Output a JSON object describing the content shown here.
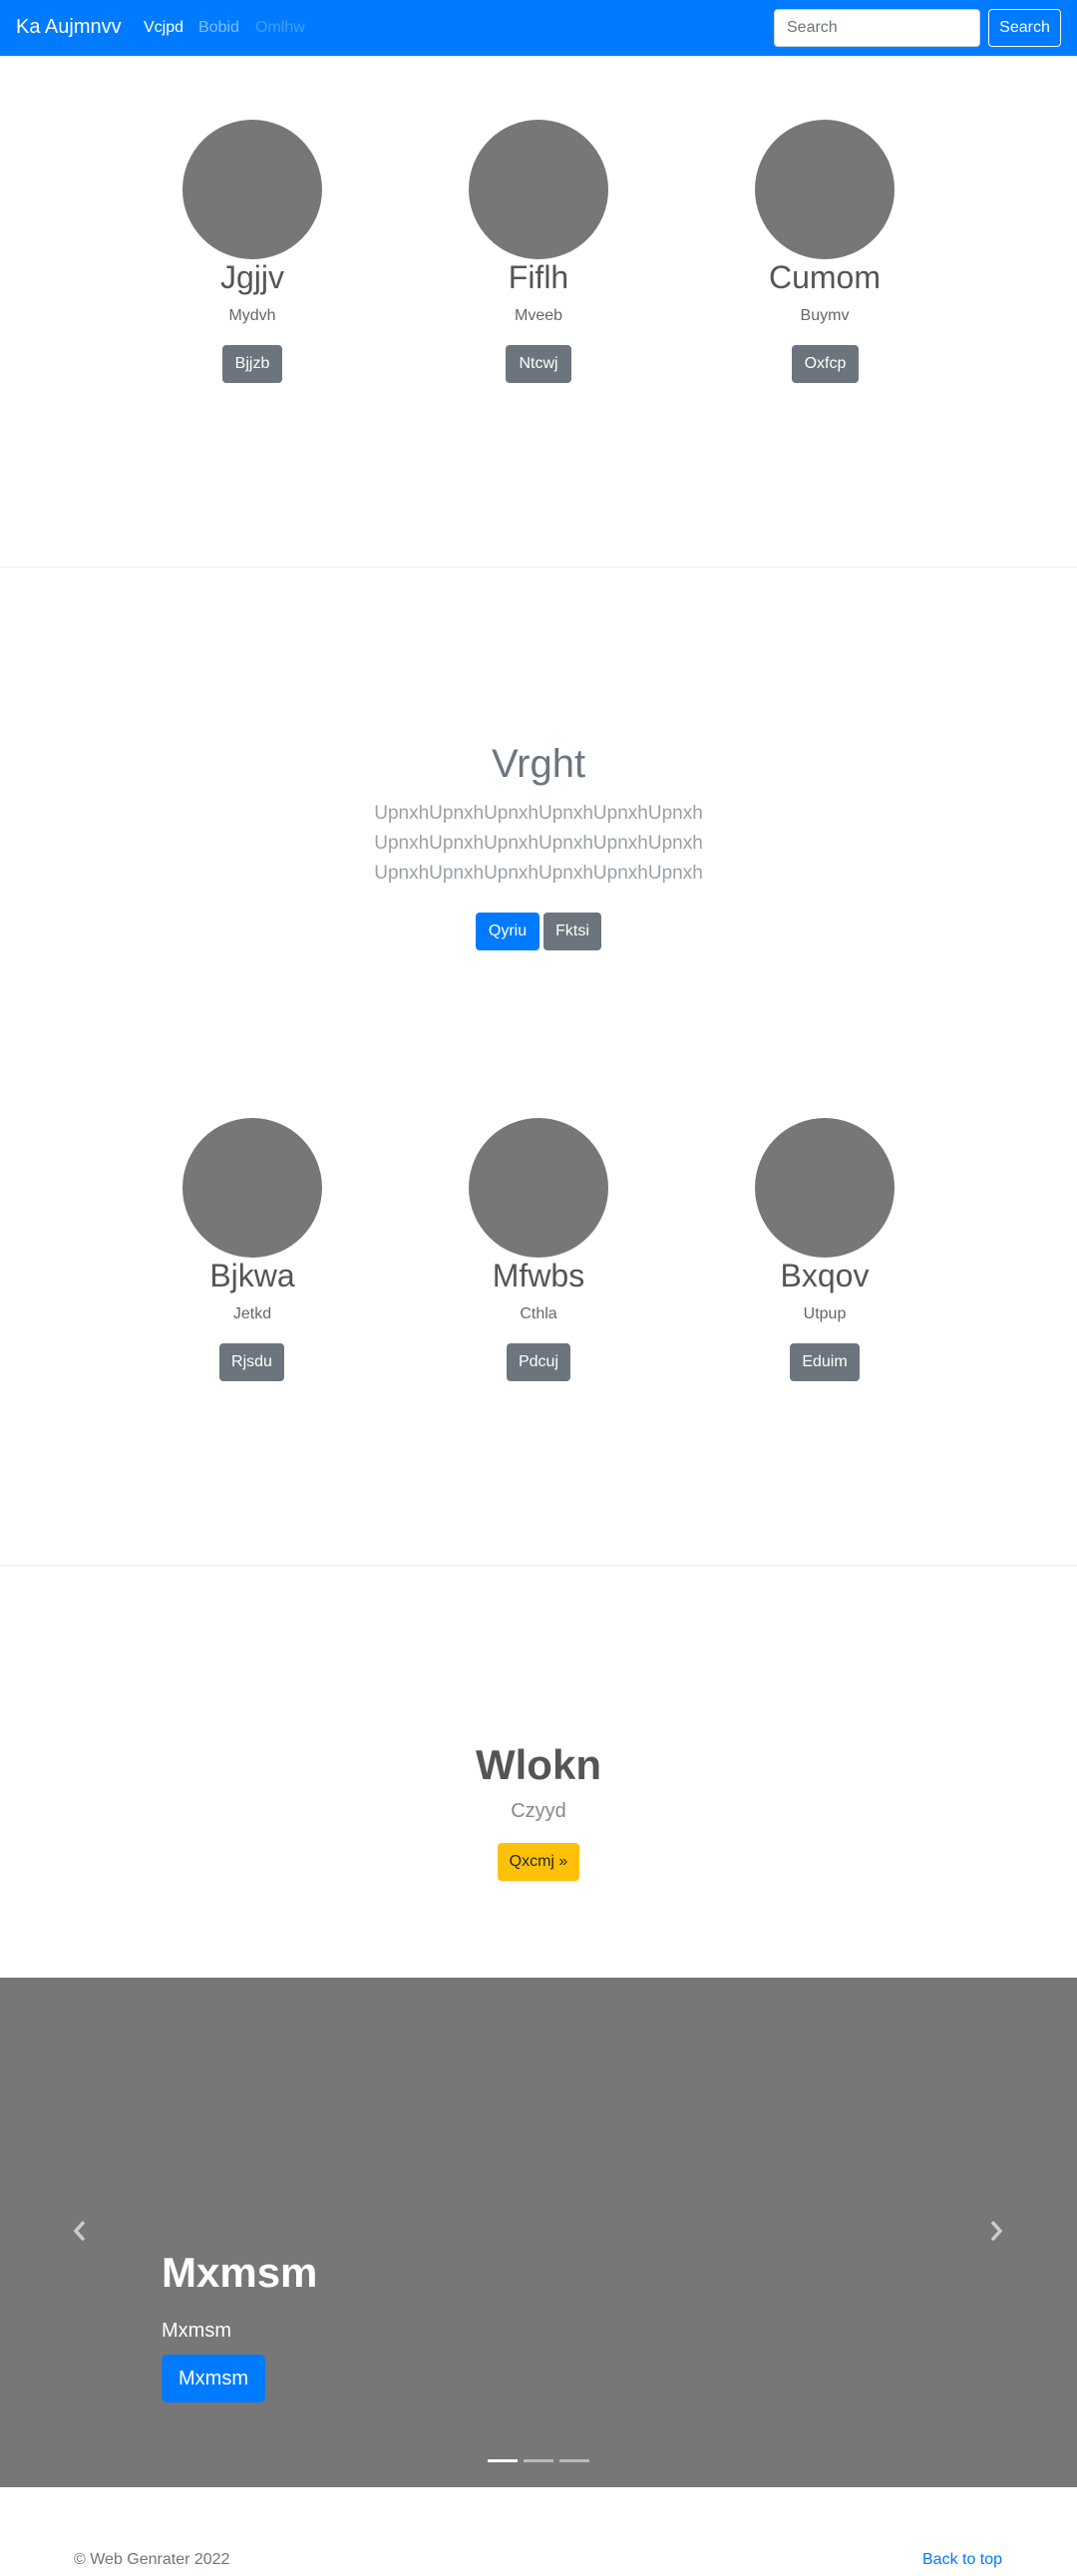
{
  "navbar": {
    "brand": "Ka Aujmnvv",
    "links": [
      "Vcjpd",
      "Bobid",
      "Omlhw"
    ],
    "search_placeholder": "Search",
    "search_button": "Search",
    "bg_color": "#007bff"
  },
  "profiles_top": [
    {
      "name": "Jgjjv",
      "subtitle": "Mydvh",
      "button": "Bjjzb"
    },
    {
      "name": "Fiflh",
      "subtitle": "Mveeb",
      "button": "Ntcwj"
    },
    {
      "name": "Cumom",
      "subtitle": "Buymv",
      "button": "Oxfcp"
    }
  ],
  "hero": {
    "title": "Vrght",
    "lines": [
      "UpnxhUpnxhUpnxhUpnxhUpnxhUpnxh",
      "UpnxhUpnxhUpnxhUpnxhUpnxhUpnxh",
      "UpnxhUpnxhUpnxhUpnxhUpnxhUpnxh"
    ],
    "primary_button": "Qyriu",
    "secondary_button": "Fktsi"
  },
  "profiles_bottom": [
    {
      "name": "Bjkwa",
      "subtitle": "Jetkd",
      "button": "Rjsdu"
    },
    {
      "name": "Mfwbs",
      "subtitle": "Cthla",
      "button": "Pdcuj"
    },
    {
      "name": "Bxqov",
      "subtitle": "Utpup",
      "button": "Eduim"
    }
  ],
  "feature": {
    "title": "Wlokn",
    "subtitle": "Czyyd",
    "button": "Qxcmj »"
  },
  "carousel": {
    "title": "Mxmsm",
    "subtitle": "Mxmsm",
    "button": "Mxmsm",
    "slide_count": 3,
    "active_slide": 1
  },
  "footer": {
    "copyright": "© Web Genrater 2022",
    "back_to_top": "Back to top"
  }
}
